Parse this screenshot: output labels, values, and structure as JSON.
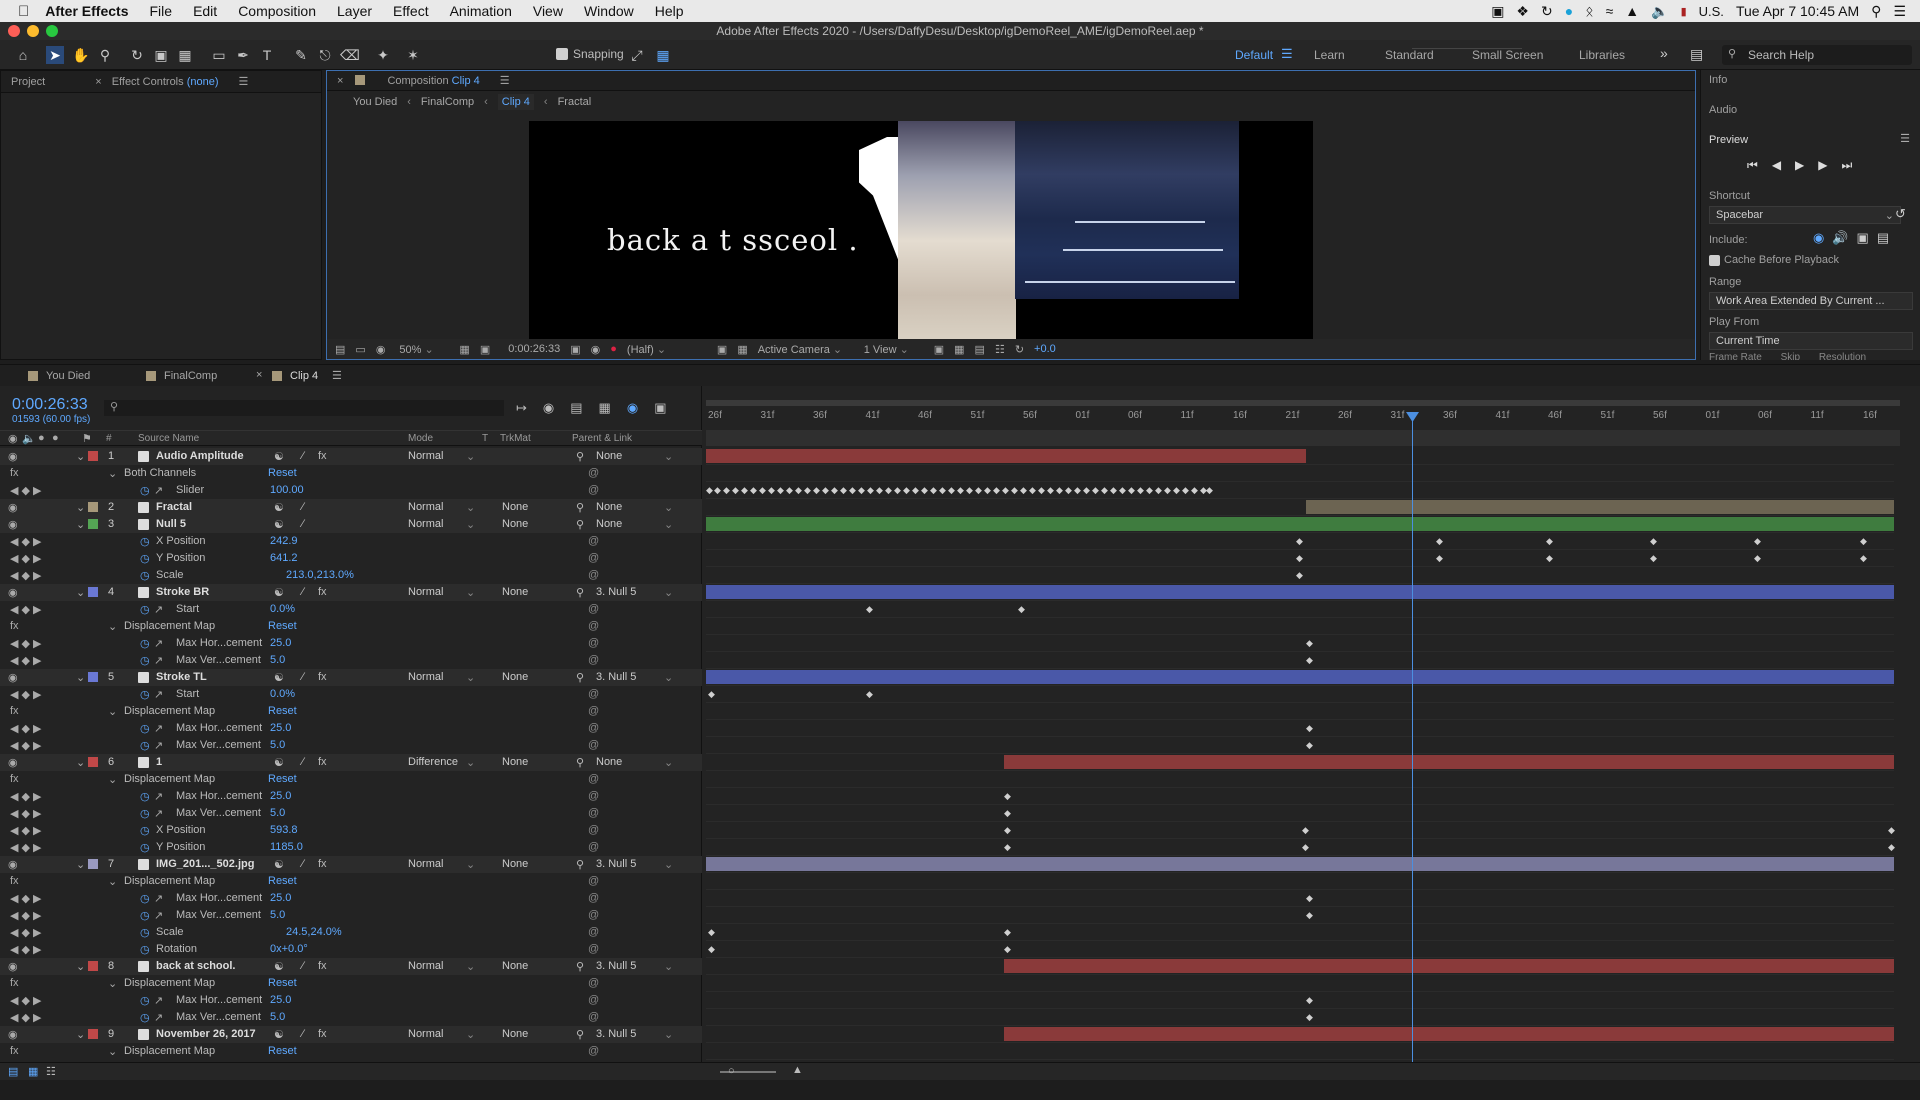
{
  "menubar": {
    "app": "After Effects",
    "items": [
      "File",
      "Edit",
      "Composition",
      "Layer",
      "Effect",
      "Animation",
      "View",
      "Window",
      "Help"
    ],
    "locale": "U.S.",
    "datetime": "Tue Apr 7  10:45 AM"
  },
  "titlebar": {
    "title": "Adobe After Effects 2020 - /Users/DaffyDesu/Desktop/igDemoReel_AME/igDemoReel.aep *"
  },
  "toolbar": {
    "snapping": "Snapping",
    "workspaces": [
      "Default",
      "Learn",
      "Standard",
      "Small Screen",
      "Libraries"
    ],
    "search_placeholder": "Search Help"
  },
  "left_panel": {
    "tab_project": "Project",
    "tab_effect_controls": "Effect Controls",
    "effect_controls_target": "(none)"
  },
  "comp_panel": {
    "tab_prefix": "Composition",
    "tab_name": "Clip 4",
    "breadcrumbs": [
      "You Died",
      "FinalComp",
      "Clip 4",
      "Fractal"
    ],
    "viewer_text": "back a t ssceol .",
    "zoom": "50%",
    "timecode": "0:00:26:33",
    "resolution": "(Half)",
    "camera": "Active Camera",
    "views": "1 View",
    "exposure": "+0.0"
  },
  "right_panel": {
    "info": "Info",
    "audio": "Audio",
    "preview": "Preview",
    "shortcut_label": "Shortcut",
    "shortcut_value": "Spacebar",
    "include_label": "Include:",
    "cache_label": "Cache Before Playback",
    "range_label": "Range",
    "range_value": "Work Area Extended By Current ...",
    "playfrom_label": "Play From",
    "playfrom_value": "Current Time",
    "cut_labels": [
      "Frame Rate",
      "Skip",
      "Resolution"
    ]
  },
  "timeline": {
    "tabs": [
      "You Died",
      "FinalComp",
      "Clip 4"
    ],
    "timecode": "0:00:26:33",
    "frame_info": "01593 (60.00 fps)",
    "col_source": "Source Name",
    "col_mode": "Mode",
    "col_t": "T",
    "col_trkmat": "TrkMat",
    "col_parent": "Parent & Link",
    "ruler": [
      "26f",
      "31f",
      "36f",
      "41f",
      "46f",
      "51f",
      "56f",
      "01f",
      "06f",
      "11f",
      "16f",
      "21f",
      "26f",
      "31f",
      "36f",
      "41f",
      "46f",
      "51f",
      "56f",
      "01f",
      "06f",
      "11f",
      "16f"
    ],
    "rows": [
      {
        "kind": "layer",
        "num": "1",
        "name": "Audio Amplitude",
        "color": "#c04848",
        "mode": "Normal",
        "trk": "",
        "parent": "None",
        "sw": "fx"
      },
      {
        "kind": "group",
        "name": "Both Channels",
        "value": "Reset"
      },
      {
        "kind": "prop",
        "name": "Slider",
        "value": "100.00",
        "ind": 2
      },
      {
        "kind": "layer",
        "num": "2",
        "name": "Fractal",
        "color": "#a6987a",
        "mode": "Normal",
        "trk": "None",
        "parent": "None",
        "sw": ""
      },
      {
        "kind": "layer",
        "num": "3",
        "name": "Null 5",
        "color": "#54a454",
        "mode": "Normal",
        "trk": "None",
        "parent": "None",
        "sw": ""
      },
      {
        "kind": "prop",
        "name": "X Position",
        "value": "242.9",
        "ind": 1
      },
      {
        "kind": "prop",
        "name": "Y Position",
        "value": "641.2",
        "ind": 1
      },
      {
        "kind": "prop",
        "name": "Scale",
        "value": "213.0,213.0%",
        "ind": 1
      },
      {
        "kind": "layer",
        "num": "4",
        "name": "Stroke BR",
        "color": "#6a78d4",
        "mode": "Normal",
        "trk": "None",
        "parent": "3. Null 5",
        "sw": "fx"
      },
      {
        "kind": "prop",
        "name": "Start",
        "value": "0.0%",
        "ind": 2
      },
      {
        "kind": "group",
        "name": "Displacement Map",
        "value": "Reset"
      },
      {
        "kind": "prop",
        "name": "Max Hor...cement",
        "value": "25.0",
        "ind": 2
      },
      {
        "kind": "prop",
        "name": "Max Ver...cement",
        "value": "5.0",
        "ind": 2
      },
      {
        "kind": "layer",
        "num": "5",
        "name": "Stroke TL",
        "color": "#6a78d4",
        "mode": "Normal",
        "trk": "None",
        "parent": "3. Null 5",
        "sw": "fx"
      },
      {
        "kind": "prop",
        "name": "Start",
        "value": "0.0%",
        "ind": 2
      },
      {
        "kind": "group",
        "name": "Displacement Map",
        "value": "Reset"
      },
      {
        "kind": "prop",
        "name": "Max Hor...cement",
        "value": "25.0",
        "ind": 2
      },
      {
        "kind": "prop",
        "name": "Max Ver...cement",
        "value": "5.0",
        "ind": 2
      },
      {
        "kind": "layer",
        "num": "6",
        "name": "1",
        "color": "#c04848",
        "mode": "Difference",
        "trk": "None",
        "parent": "None",
        "sw": "fx"
      },
      {
        "kind": "group",
        "name": "Displacement Map",
        "value": "Reset"
      },
      {
        "kind": "prop",
        "name": "Max Hor...cement",
        "value": "25.0",
        "ind": 2
      },
      {
        "kind": "prop",
        "name": "Max Ver...cement",
        "value": "5.0",
        "ind": 2
      },
      {
        "kind": "prop",
        "name": "X Position",
        "value": "593.8",
        "ind": 1
      },
      {
        "kind": "prop",
        "name": "Y Position",
        "value": "1185.0",
        "ind": 1
      },
      {
        "kind": "layer",
        "num": "7",
        "name": "IMG_201..._502.jpg",
        "color": "#9a9ac0",
        "mode": "Normal",
        "trk": "None",
        "parent": "3. Null 5",
        "sw": "fx"
      },
      {
        "kind": "group",
        "name": "Displacement Map",
        "value": "Reset"
      },
      {
        "kind": "prop",
        "name": "Max Hor...cement",
        "value": "25.0",
        "ind": 2
      },
      {
        "kind": "prop",
        "name": "Max Ver...cement",
        "value": "5.0",
        "ind": 2
      },
      {
        "kind": "prop",
        "name": "Scale",
        "value": "24.5,24.0%",
        "ind": 1
      },
      {
        "kind": "prop",
        "name": "Rotation",
        "value": "0x+0.0°",
        "ind": 1
      },
      {
        "kind": "layer",
        "num": "8",
        "name": "back at school.",
        "color": "#c04848",
        "mode": "Normal",
        "trk": "None",
        "parent": "3. Null 5",
        "sw": "fx"
      },
      {
        "kind": "group",
        "name": "Displacement Map",
        "value": "Reset"
      },
      {
        "kind": "prop",
        "name": "Max Hor...cement",
        "value": "25.0",
        "ind": 2
      },
      {
        "kind": "prop",
        "name": "Max Ver...cement",
        "value": "5.0",
        "ind": 2
      },
      {
        "kind": "layer",
        "num": "9",
        "name": "November 26, 2017",
        "color": "#c04848",
        "mode": "Normal",
        "trk": "None",
        "parent": "3. Null 5",
        "sw": "fx"
      },
      {
        "kind": "group",
        "name": "Displacement Map",
        "value": "Reset"
      }
    ]
  }
}
